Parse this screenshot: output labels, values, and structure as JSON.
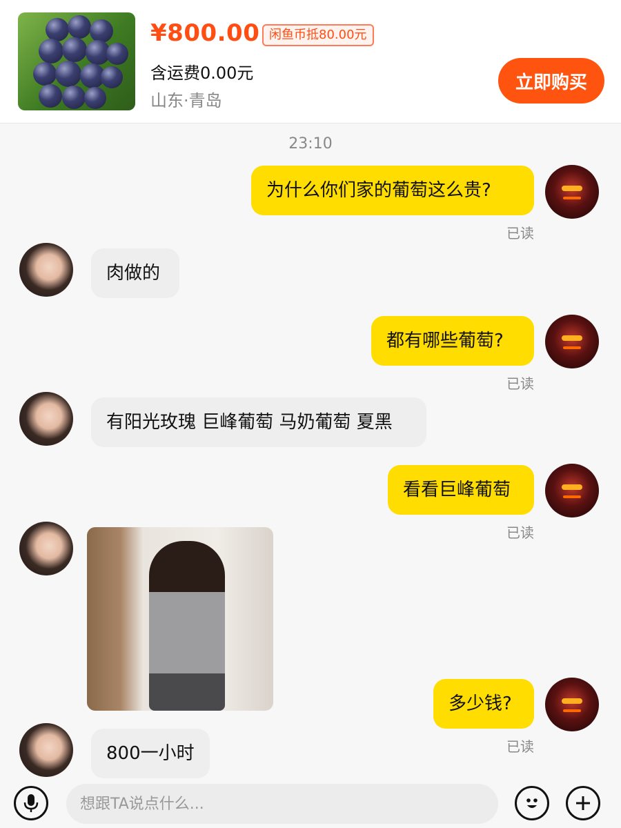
{
  "product": {
    "price": "¥800.00",
    "coin_deduct": "闲鱼币抵80.00元",
    "shipping": "含运费0.00元",
    "location": "山东·青岛",
    "buy_label": "立即购买"
  },
  "chat": {
    "time": "23:10",
    "read_label": "已读",
    "messages": [
      {
        "from": "me",
        "text": "为什么你们家的葡萄这么贵?"
      },
      {
        "from": "them",
        "text": "肉做的"
      },
      {
        "from": "me",
        "text": "都有哪些葡萄?"
      },
      {
        "from": "them",
        "text": "有阳光玫瑰 巨峰葡萄 马奶葡萄 夏黑"
      },
      {
        "from": "me",
        "text": "看看巨峰葡萄"
      },
      {
        "from": "them",
        "text": ""
      },
      {
        "from": "me",
        "text": "多少钱?"
      },
      {
        "from": "them",
        "text": "800一小时"
      }
    ]
  },
  "composer": {
    "placeholder": "想跟TA说点什么...",
    "voice_icon": "microphone-icon",
    "emoji_icon": "emoji-icon",
    "add_icon": "plus-icon"
  }
}
